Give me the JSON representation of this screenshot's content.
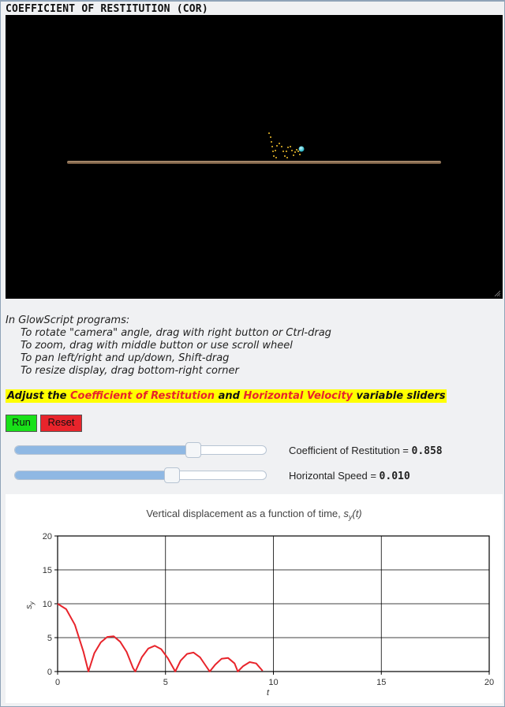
{
  "page": {
    "title": "COEFFICIENT OF RESTITUTION (COR)"
  },
  "instructions": {
    "heading": "In GlowScript programs:",
    "lines": [
      "To rotate \"camera\" angle, drag with right button or Ctrl-drag",
      "To zoom, drag with middle button or use scroll wheel",
      "To pan left/right and up/down, Shift-drag",
      "To resize display, drag bottom-right corner"
    ]
  },
  "headline": {
    "prefix": "Adjust the ",
    "cor_text": "Coefficient of Restitution",
    "and": " and ",
    "hv_text": "Horizontal Velocity",
    "suffix": " variable sliders"
  },
  "buttons": {
    "run": "Run",
    "reset": "Reset"
  },
  "controls": {
    "cor": {
      "label": "Coefficient of Restitution = ",
      "value": "0.858",
      "level": 0.72
    },
    "speed": {
      "label": "Horizontal Speed = ",
      "value": "0.010",
      "level": 0.63
    }
  },
  "colors": {
    "curve": "#e8242b",
    "ball": "#19c9d6",
    "trail": "#f2c12e",
    "floor": "#8a6e52",
    "headline_bg": "#ffff00",
    "run": "#19e119",
    "reset": "#e8242b"
  },
  "chart_data": {
    "type": "line",
    "title_prefix": "Vertical displacement as a function of time, ",
    "title_var": "s",
    "title_sub": "y",
    "title_arg": "(t)",
    "xlabel": "t",
    "ylabel": "s",
    "ylabel_sub": "y",
    "xlim": [
      0,
      20
    ],
    "ylim": [
      0,
      20
    ],
    "x_ticks": [
      "0",
      "5",
      "10",
      "15",
      "20"
    ],
    "y_ticks": [
      "0",
      "5",
      "10",
      "15",
      "20"
    ],
    "grid": true,
    "series": [
      {
        "color": "#e8242b",
        "x": [
          0,
          0.4,
          0.8,
          1.2,
          1.43,
          1.7,
          2.0,
          2.3,
          2.6,
          2.9,
          3.2,
          3.5,
          3.6,
          3.9,
          4.2,
          4.5,
          4.8,
          5.1,
          5.4,
          5.45,
          5.7,
          6.0,
          6.3,
          6.6,
          6.9,
          7.05,
          7.3,
          7.6,
          7.9,
          8.2,
          8.35,
          8.6,
          8.9,
          9.2,
          9.5
        ],
        "y": [
          10,
          9.2,
          6.9,
          2.9,
          0,
          2.7,
          4.3,
          5.1,
          5.2,
          4.4,
          2.9,
          0.5,
          0,
          2.1,
          3.4,
          3.8,
          3.3,
          2.0,
          0.3,
          0,
          1.6,
          2.6,
          2.8,
          2.1,
          0.7,
          0,
          1.0,
          1.9,
          2.0,
          1.2,
          0,
          0.8,
          1.4,
          1.2,
          0.1
        ]
      }
    ]
  }
}
